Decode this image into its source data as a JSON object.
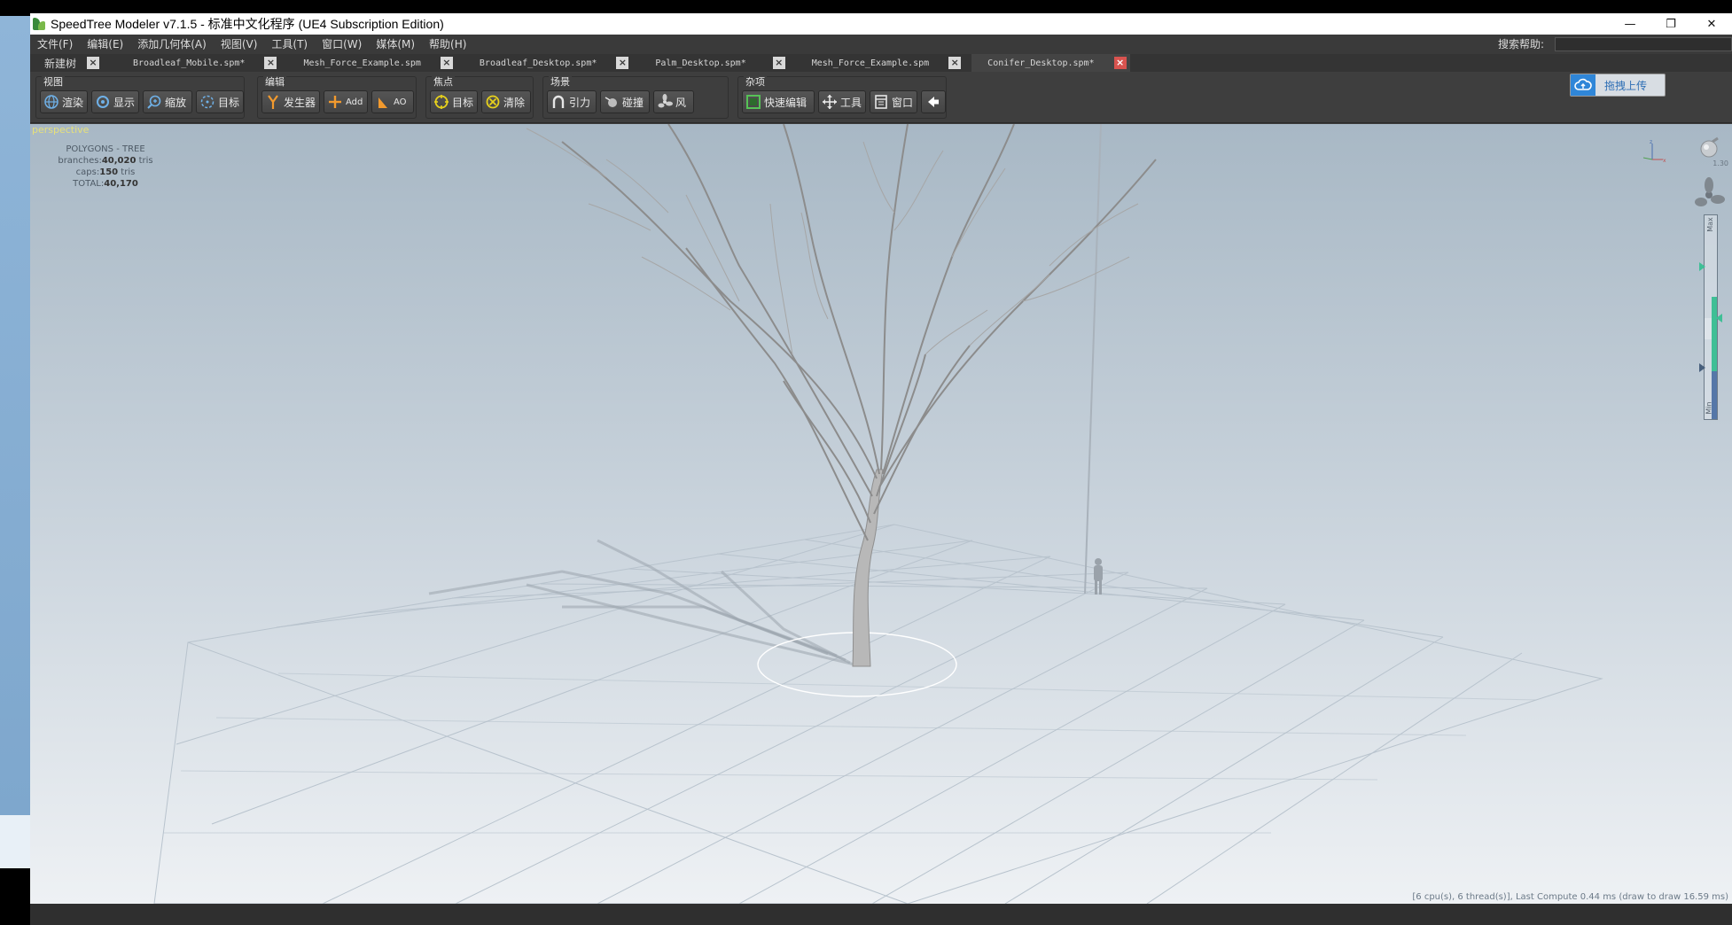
{
  "window": {
    "title": "SpeedTree Modeler v7.1.5 - 标准中文化程序 (UE4 Subscription Edition)",
    "controls": {
      "minimize": "—",
      "maximize": "❐",
      "close": "✕"
    }
  },
  "menu": {
    "items": [
      "文件(F)",
      "编辑(E)",
      "添加几何体(A)",
      "视图(V)",
      "工具(T)",
      "窗口(W)",
      "媒体(M)",
      "帮助(H)"
    ],
    "help_label": "搜索帮助:",
    "help_value": ""
  },
  "tabs": [
    {
      "label": "新建树",
      "active": false
    },
    {
      "label": "Broadleaf_Mobile.spm*",
      "active": false
    },
    {
      "label": "Mesh_Force_Example.spm",
      "active": false
    },
    {
      "label": "Broadleaf_Desktop.spm*",
      "active": false
    },
    {
      "label": "Palm_Desktop.spm*",
      "active": false
    },
    {
      "label": "Mesh_Force_Example.spm",
      "active": false
    },
    {
      "label": "Conifer_Desktop.spm*",
      "active": true
    }
  ],
  "toolbar": {
    "groups": [
      {
        "label": "视图",
        "buttons": [
          "渲染",
          "显示",
          "缩放",
          "目标"
        ]
      },
      {
        "label": "编辑",
        "buttons": [
          "发生器",
          "Add",
          "AO"
        ]
      },
      {
        "label": "焦点",
        "buttons": [
          "目标",
          "清除"
        ]
      },
      {
        "label": "场景",
        "buttons": [
          "引力",
          "碰撞",
          "风"
        ]
      },
      {
        "label": "杂项",
        "buttons": [
          "快速编辑",
          "工具",
          "窗口",
          ""
        ]
      }
    ],
    "upload_label": "拖拽上传"
  },
  "viewport": {
    "camera": "perspective",
    "stats": {
      "header": "POLYGONS - TREE",
      "branches_label": "branches:",
      "branches_value": "40,020",
      "branches_unit": " tris",
      "caps_label": "caps:",
      "caps_value": "150",
      "caps_unit": " tris",
      "total_label": "TOTAL:",
      "total_value": "40,170"
    },
    "lamp_value": "1.30",
    "lod_max_label": "Max",
    "lod_min_label": "Min",
    "perf_text": "[6 cpu(s), 6 thread(s)], Last Compute 0.44 ms (draw to draw 16.59 ms)"
  },
  "colors": {
    "accent_active_tab_close": "#d9534f",
    "upload_blue": "#2f86d8",
    "lod_green": "#3fbf96",
    "lod_blue": "#5577a8",
    "camera_label": "#e6e07a"
  }
}
